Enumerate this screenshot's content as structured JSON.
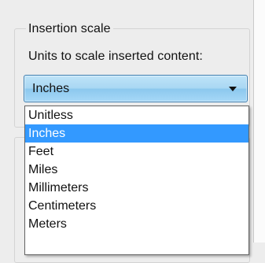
{
  "insertion_scale": {
    "group_title": "Insertion scale",
    "field_label": "Units to scale inserted content:",
    "selected_value": "Inches",
    "options": [
      "Unitless",
      "Inches",
      "Feet",
      "Miles",
      "Millimeters",
      "Centimeters",
      "Meters"
    ],
    "highlighted_option": "Inches"
  },
  "colors": {
    "highlight": "#3399ff",
    "combo_border": "#3c7fb1",
    "combo_fill": "#a9d7f3"
  }
}
